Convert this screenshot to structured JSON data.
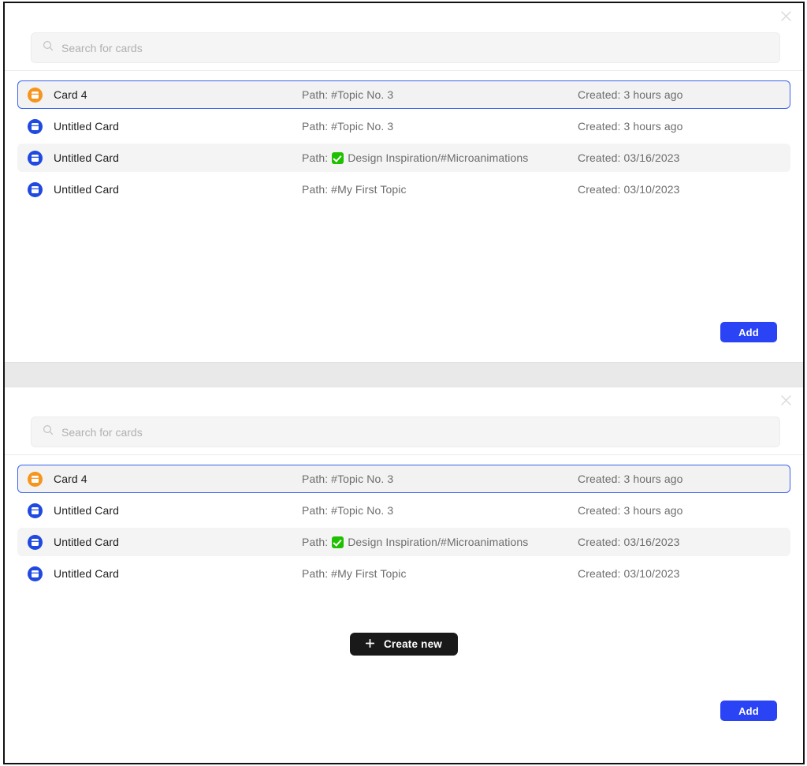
{
  "colors": {
    "accent_blue": "#2943f5",
    "selected_border": "#3b63f0",
    "icon_orange": "#f7941e",
    "icon_blue": "#1f49e0",
    "create_dark": "#191919",
    "check_green": "#1ec000",
    "row_shaded": "#f4f4f4",
    "gap_band": "#e9e9e9"
  },
  "search": {
    "placeholder": "Search for cards",
    "value": "",
    "icon": "search-icon"
  },
  "close": {
    "icon": "close-icon",
    "label": "Close"
  },
  "columns": {
    "path_prefix": "Path:",
    "created_prefix": "Created:"
  },
  "rows": [
    {
      "title": "Card 4",
      "path": "Path: #Topic No. 3",
      "created": "Created: 3 hours ago",
      "icon": "card-icon",
      "icon_color": "#f7941e",
      "selected": true,
      "shaded": false,
      "has_check": false
    },
    {
      "title": "Untitled Card",
      "path": "Path: #Topic No. 3",
      "created": "Created: 3 hours ago",
      "icon": "card-icon",
      "icon_color": "#1f49e0",
      "selected": false,
      "shaded": false,
      "has_check": false
    },
    {
      "title": "Untitled Card",
      "path_prefix": "Path:",
      "path": "Design Inspiration/#Microanimations",
      "created": "Created: 03/16/2023",
      "icon": "card-icon",
      "icon_color": "#1f49e0",
      "selected": false,
      "shaded": true,
      "has_check": true
    },
    {
      "title": "Untitled Card",
      "path": "Path: #My First Topic",
      "created": "Created: 03/10/2023",
      "icon": "card-icon",
      "icon_color": "#1f49e0",
      "selected": false,
      "shaded": false,
      "has_check": false
    }
  ],
  "panel_one": {
    "add_label": "Add"
  },
  "panel_two": {
    "create_label": "Create new",
    "create_icon": "plus-icon",
    "add_label": "Add"
  }
}
